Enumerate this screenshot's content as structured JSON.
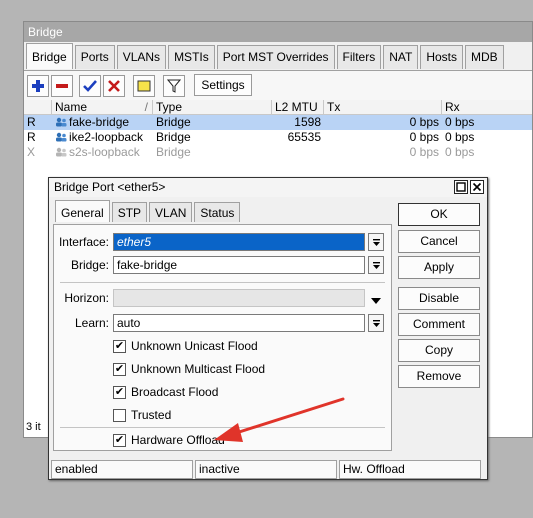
{
  "bridge": {
    "title": "Bridge",
    "tabs": [
      "Bridge",
      "Ports",
      "VLANs",
      "MSTIs",
      "Port MST Overrides",
      "Filters",
      "NAT",
      "Hosts",
      "MDB"
    ],
    "settings_label": "Settings",
    "columns": [
      "",
      "Name",
      "Type",
      "L2 MTU",
      "Tx",
      "Rx"
    ],
    "rows": [
      {
        "flag": "R",
        "name": "fake-bridge",
        "type": "Bridge",
        "l2mtu": "1598",
        "tx": "0 bps",
        "rx": "0 bps"
      },
      {
        "flag": "R",
        "name": "ike2-loopback",
        "type": "Bridge",
        "l2mtu": "65535",
        "tx": "0 bps",
        "rx": "0 bps"
      },
      {
        "flag": "X",
        "name": "s2s-loopback",
        "type": "Bridge",
        "l2mtu": "",
        "tx": "0 bps",
        "rx": "0 bps"
      }
    ],
    "count_text": "3 it"
  },
  "dialog": {
    "title": "Bridge Port <ether5>",
    "tabs": [
      "General",
      "STP",
      "VLAN",
      "Status"
    ],
    "interface_label": "Interface:",
    "interface_value": "ether5",
    "bridge_label": "Bridge:",
    "bridge_value": "fake-bridge",
    "horizon_label": "Horizon:",
    "horizon_value": "",
    "learn_label": "Learn:",
    "learn_value": "auto",
    "checkboxes": [
      {
        "label": "Unknown Unicast Flood",
        "checked": true
      },
      {
        "label": "Unknown Multicast Flood",
        "checked": true
      },
      {
        "label": "Broadcast Flood",
        "checked": true
      },
      {
        "label": "Trusted",
        "checked": false
      },
      {
        "label": "Hardware Offload",
        "checked": true
      }
    ],
    "buttons": [
      "OK",
      "Cancel",
      "Apply",
      "Disable",
      "Comment",
      "Copy",
      "Remove"
    ],
    "status": [
      "enabled",
      "inactive",
      "Hw. Offload"
    ]
  },
  "colors": {
    "selection": "#0a64c8",
    "row_selected": "#b9d3f5",
    "annotation_arrow": "#e0342a"
  }
}
